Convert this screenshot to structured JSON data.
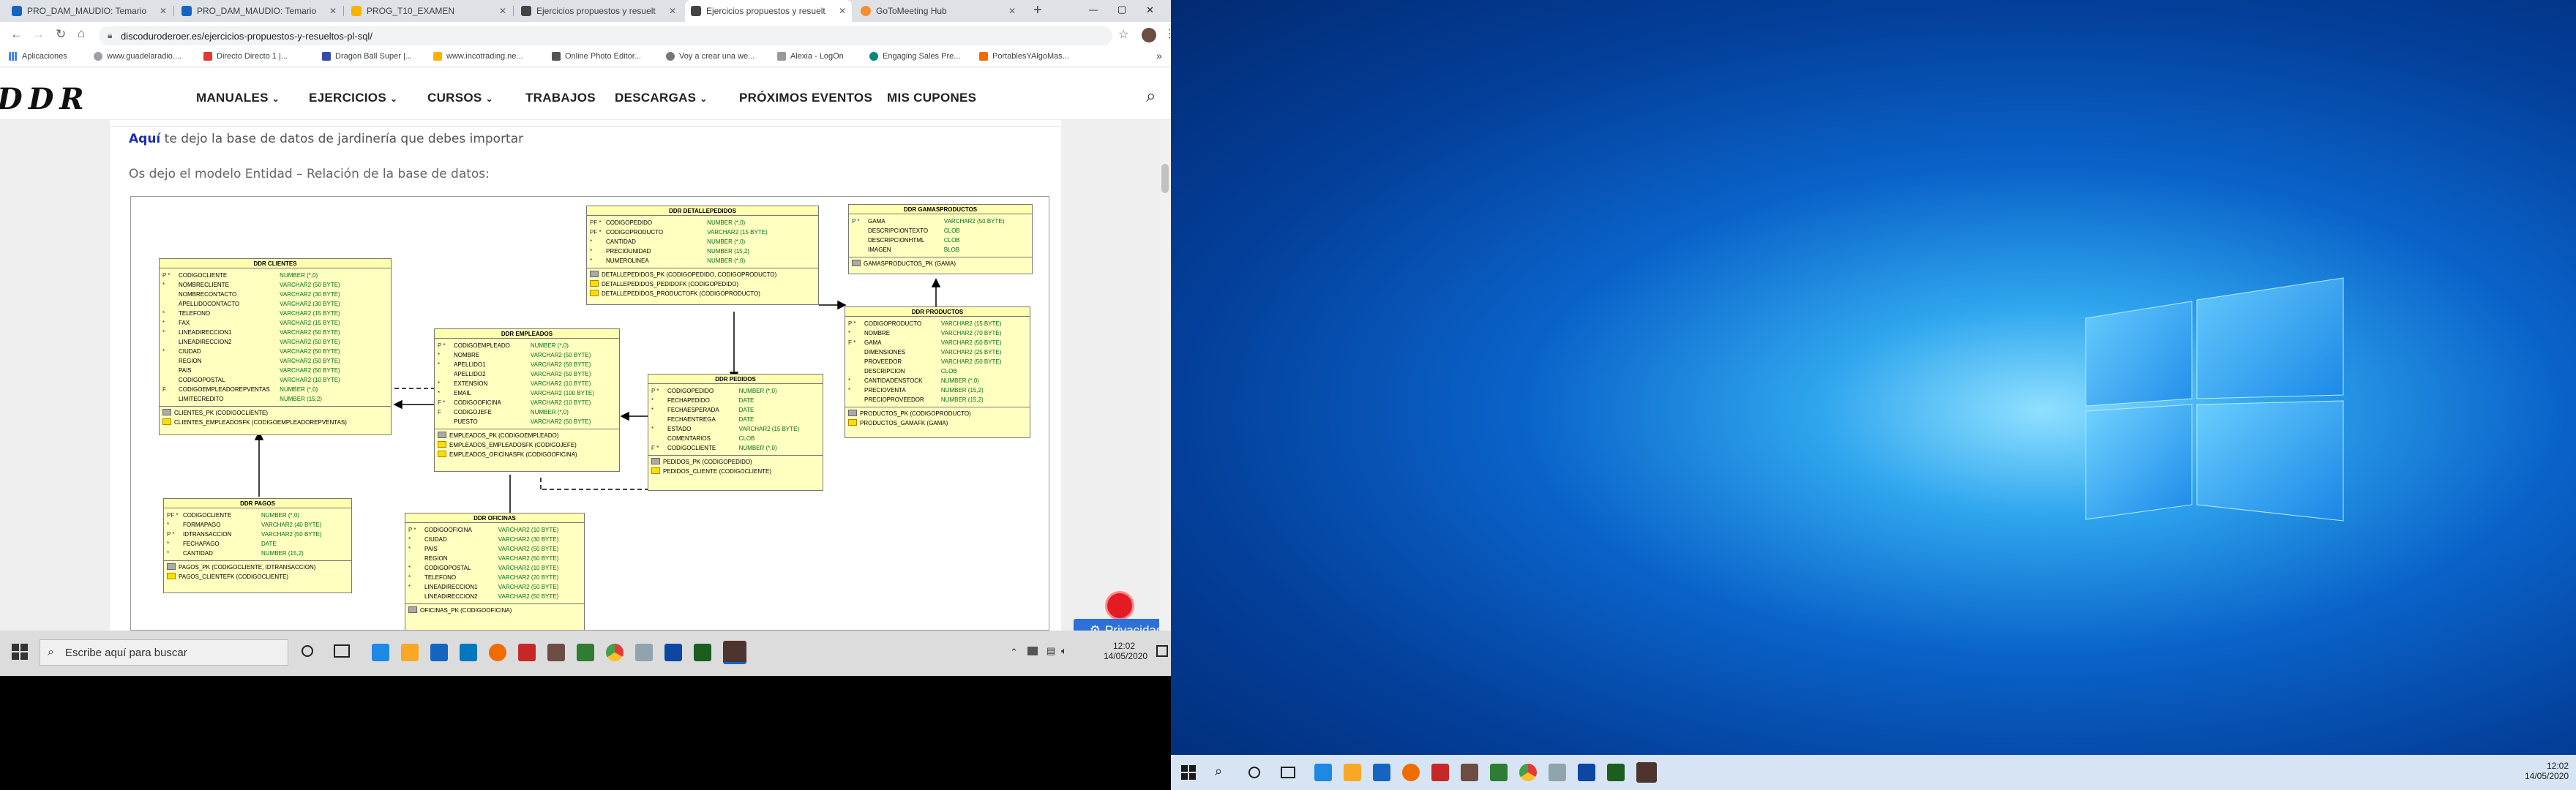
{
  "browser": {
    "tabs": [
      {
        "label": "PRO_DAM_MAUDIO: Temario",
        "favicon_color": "#1565c0"
      },
      {
        "label": "PRO_DAM_MAUDIO: Temario",
        "favicon_color": "#1565c0"
      },
      {
        "label": "PROG_T10_EXAMEN",
        "favicon_color": "#f4b400"
      },
      {
        "label": "Ejercicios propuestos y resuelt",
        "favicon_color": "#444444"
      },
      {
        "label": "Ejercicios propuestos y resuelt",
        "favicon_color": "#444444"
      },
      {
        "label": "GoToMeeting Hub",
        "favicon_color": "#f68d2e"
      }
    ],
    "tab_close": "✕",
    "new_tab": "+",
    "window_controls": {
      "minimize": "—",
      "maximize": "▢",
      "close": "✕"
    },
    "url": "discoduroderoer.es/ejercicios-propuestos-y-resueltos-pl-sql/",
    "bookmarks": [
      "Aplicaciones",
      "www.guadelaradio....",
      "Directo Directo 1 |...",
      "Dragon Ball Super |...",
      "www.incotrading.ne...",
      "Online Photo Editor...",
      "Voy a crear una we...",
      "Alexia - LogOn",
      "Engaging Sales Pre...",
      "PortablesYAlgoMas..."
    ],
    "bookmarks_more": "»"
  },
  "site": {
    "logo": "DDR",
    "nav": [
      "MANUALES",
      "EJERCICIOS",
      "CURSOS",
      "TRABAJOS",
      "DESCARGAS",
      "PRÓXIMOS EVENTOS",
      "MIS CUPONES"
    ],
    "nav_dropdown": "⌄",
    "search_icon": "⌕",
    "para1_link": "Aquí",
    "para1_rest": " te dejo la base de datos de jardinería que debes importar",
    "para2": "Os dejo el modelo Entidad – Relación de la base de datos:",
    "privacy_button": "Privacidad",
    "privacy_gear": "⚙"
  },
  "diagram": {
    "entities": [
      {
        "id": "clientes",
        "title": "DDR CLIENTES",
        "rows": [
          [
            "P *",
            "CODIGOCLIENTE",
            "NUMBER (*,0)"
          ],
          [
            "*",
            "NOMBRECLIENTE",
            "VARCHAR2 (50 BYTE)"
          ],
          [
            "",
            "NOMBRECONTACTO",
            "VARCHAR2 (30 BYTE)"
          ],
          [
            "",
            "APELLIDOCONTACTO",
            "VARCHAR2 (30 BYTE)"
          ],
          [
            "*",
            "TELEFONO",
            "VARCHAR2 (15 BYTE)"
          ],
          [
            "*",
            "FAX",
            "VARCHAR2 (15 BYTE)"
          ],
          [
            "*",
            "LINEADIRECCION1",
            "VARCHAR2 (50 BYTE)"
          ],
          [
            "",
            "LINEADIRECCION2",
            "VARCHAR2 (50 BYTE)"
          ],
          [
            "*",
            "CIUDAD",
            "VARCHAR2 (50 BYTE)"
          ],
          [
            "",
            "REGION",
            "VARCHAR2 (50 BYTE)"
          ],
          [
            "",
            "PAIS",
            "VARCHAR2 (50 BYTE)"
          ],
          [
            "",
            "CODIGOPOSTAL",
            "VARCHAR2 (10 BYTE)"
          ],
          [
            "F",
            "CODIGOEMPLEADOREPVENTAS",
            "NUMBER (*,0)"
          ],
          [
            "",
            "LIMITECREDITO",
            "NUMBER (15,2)"
          ]
        ],
        "keys": [
          {
            "pk": true,
            "label": "CLIENTES_PK (CODIGOCLIENTE)"
          },
          {
            "pk": false,
            "label": "CLIENTES_EMPLEADOSFK (CODIGOEMPLEADOREPVENTAS)"
          }
        ]
      },
      {
        "id": "empleados",
        "title": "DDR EMPLEADOS",
        "rows": [
          [
            "P *",
            "CODIGOEMPLEADO",
            "NUMBER (*,0)"
          ],
          [
            "*",
            "NOMBRE",
            "VARCHAR2 (50 BYTE)"
          ],
          [
            "*",
            "APELLIDO1",
            "VARCHAR2 (50 BYTE)"
          ],
          [
            "",
            "APELLIDO2",
            "VARCHAR2 (50 BYTE)"
          ],
          [
            "*",
            "EXTENSION",
            "VARCHAR2 (10 BYTE)"
          ],
          [
            "*",
            "EMAIL",
            "VARCHAR2 (100 BYTE)"
          ],
          [
            "F *",
            "CODIGOOFICINA",
            "VARCHAR2 (10 BYTE)"
          ],
          [
            "F",
            "CODIGOJEFE",
            "NUMBER (*,0)"
          ],
          [
            "",
            "PUESTO",
            "VARCHAR2 (50 BYTE)"
          ]
        ],
        "keys": [
          {
            "pk": true,
            "label": "EMPLEADOS_PK (CODIGOEMPLEADO)"
          },
          {
            "pk": false,
            "label": "EMPLEADOS_EMPLEADOSFK (CODIGOJEFE)"
          },
          {
            "pk": false,
            "label": "EMPLEADOS_OFICINASFK (CODIGOOFICINA)"
          }
        ]
      },
      {
        "id": "detallepedidos",
        "title": "DDR DETALLEPEDIDOS",
        "rows": [
          [
            "PF *",
            "CODIGOPEDIDO",
            "NUMBER (*,0)"
          ],
          [
            "PF *",
            "CODIGOPRODUCTO",
            "VARCHAR2 (15 BYTE)"
          ],
          [
            "*",
            "CANTIDAD",
            "NUMBER (*,0)"
          ],
          [
            "*",
            "PRECIOUNIDAD",
            "NUMBER (15,2)"
          ],
          [
            "*",
            "NUMEROLINEA",
            "NUMBER (*,0)"
          ]
        ],
        "keys": [
          {
            "pk": true,
            "label": "DETALLEPEDIDOS_PK (CODIGOPEDIDO, CODIGOPRODUCTO)"
          },
          {
            "pk": false,
            "label": "DETALLEPEDIDOS_PEDIDOFK (CODIGOPEDIDO)"
          },
          {
            "pk": false,
            "label": "DETALLEPEDIDOS_PRODUCTOFK (CODIGOPRODUCTO)"
          }
        ]
      },
      {
        "id": "gamasproductos",
        "title": "DDR GAMASPRODUCTOS",
        "rows": [
          [
            "P *",
            "GAMA",
            "VARCHAR2 (50 BYTE)"
          ],
          [
            "",
            "DESCRIPCIONTEXTO",
            "CLOB"
          ],
          [
            "",
            "DESCRIPCIONHTML",
            "CLOB"
          ],
          [
            "",
            "IMAGEN",
            "BLOB"
          ]
        ],
        "keys": [
          {
            "pk": true,
            "label": "GAMASPRODUCTOS_PK (GAMA)"
          }
        ]
      },
      {
        "id": "productos",
        "title": "DDR PRODUCTOS",
        "rows": [
          [
            "P *",
            "CODIGOPRODUCTO",
            "VARCHAR2 (15 BYTE)"
          ],
          [
            "*",
            "NOMBRE",
            "VARCHAR2 (70 BYTE)"
          ],
          [
            "F *",
            "GAMA",
            "VARCHAR2 (50 BYTE)"
          ],
          [
            "",
            "DIMENSIONES",
            "VARCHAR2 (25 BYTE)"
          ],
          [
            "",
            "PROVEEDOR",
            "VARCHAR2 (50 BYTE)"
          ],
          [
            "",
            "DESCRIPCION",
            "CLOB"
          ],
          [
            "*",
            "CANTIDADENSTOCK",
            "NUMBER (*,0)"
          ],
          [
            "*",
            "PRECIOVENTA",
            "NUMBER (15,2)"
          ],
          [
            "",
            "PRECIOPROVEEDOR",
            "NUMBER (15,2)"
          ]
        ],
        "keys": [
          {
            "pk": true,
            "label": "PRODUCTOS_PK (CODIGOPRODUCTO)"
          },
          {
            "pk": false,
            "label": "PRODUCTOS_GAMAFK (GAMA)"
          }
        ]
      },
      {
        "id": "pedidos",
        "title": "DDR PEDIDOS",
        "rows": [
          [
            "P *",
            "CODIGOPEDIDO",
            "NUMBER (*,0)"
          ],
          [
            "*",
            "FECHAPEDIDO",
            "DATE"
          ],
          [
            "*",
            "FECHAESPERADA",
            "DATE"
          ],
          [
            "",
            "FECHAENTREGA",
            "DATE"
          ],
          [
            "*",
            "ESTADO",
            "VARCHAR2 (15 BYTE)"
          ],
          [
            "",
            "COMENTARIOS",
            "CLOB"
          ],
          [
            "F *",
            "CODIGOCLIENTE",
            "NUMBER (*,0)"
          ]
        ],
        "keys": [
          {
            "pk": true,
            "label": "PEDIDOS_PK (CODIGOPEDIDO)"
          },
          {
            "pk": false,
            "label": "PEDIDOS_CLIENTE (CODIGOCLIENTE)"
          }
        ]
      },
      {
        "id": "pagos",
        "title": "DDR PAGOS",
        "rows": [
          [
            "PF *",
            "CODIGOCLIENTE",
            "NUMBER (*,0)"
          ],
          [
            "*",
            "FORMAPAGO",
            "VARCHAR2 (40 BYTE)"
          ],
          [
            "P *",
            "IDTRANSACCION",
            "VARCHAR2 (50 BYTE)"
          ],
          [
            "*",
            "FECHAPAGO",
            "DATE"
          ],
          [
            "*",
            "CANTIDAD",
            "NUMBER (15,2)"
          ]
        ],
        "keys": [
          {
            "pk": true,
            "label": "PAGOS_PK (CODIGOCLIENTE, IDTRANSACCION)"
          },
          {
            "pk": false,
            "label": "PAGOS_CLIENTEFK (CODIGOCLIENTE)"
          }
        ]
      },
      {
        "id": "oficinas",
        "title": "DDR OFICINAS",
        "rows": [
          [
            "P *",
            "CODIGOOFICINA",
            "VARCHAR2 (10 BYTE)"
          ],
          [
            "*",
            "CIUDAD",
            "VARCHAR2 (30 BYTE)"
          ],
          [
            "*",
            "PAIS",
            "VARCHAR2 (50 BYTE)"
          ],
          [
            "",
            "REGION",
            "VARCHAR2 (50 BYTE)"
          ],
          [
            "*",
            "CODIGOPOSTAL",
            "VARCHAR2 (10 BYTE)"
          ],
          [
            "*",
            "TELEFONO",
            "VARCHAR2 (20 BYTE)"
          ],
          [
            "*",
            "LINEADIRECCION1",
            "VARCHAR2 (50 BYTE)"
          ],
          [
            "",
            "LINEADIRECCION2",
            "VARCHAR2 (50 BYTE)"
          ]
        ],
        "keys": [
          {
            "pk": true,
            "label": "OFICINAS_PK (CODIGOOFICINA)"
          }
        ]
      }
    ]
  },
  "taskbar_left": {
    "search_placeholder": "Escribe aquí para buscar",
    "time": "12:02",
    "date": "14/05/2020"
  },
  "taskbar_right": {
    "time": "12:02",
    "date": "14/05/2020"
  }
}
